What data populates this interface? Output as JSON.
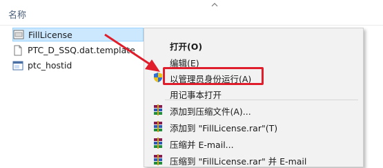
{
  "header": {
    "column_name": "名称"
  },
  "files": [
    {
      "name": "FillLicense",
      "icon": "shortcut-app-icon",
      "selected": true
    },
    {
      "name": "PTC_D_SSQ.dat.template",
      "icon": "document-file-icon",
      "selected": false
    },
    {
      "name": "ptc_hostid",
      "icon": "app-file-icon",
      "selected": false
    }
  ],
  "context_menu": {
    "items": [
      {
        "label": "打开(O)",
        "icon": "",
        "bold": true
      },
      {
        "label": "编辑(E)",
        "icon": ""
      },
      {
        "label": "以管理员身份运行(A)",
        "icon": "uac-shield-icon",
        "highlighted": true
      },
      {
        "label": "用记事本打开",
        "icon": ""
      },
      {
        "label": "添加到压缩文件(A)...",
        "icon": "winrar-icon"
      },
      {
        "label": "添加到 \"FillLicense.rar\"(T)",
        "icon": "winrar-icon"
      },
      {
        "label": "压缩并 E-mail...",
        "icon": "winrar-icon"
      },
      {
        "label": "压缩到 \"FillLicense.rar\" 并 E-mail",
        "icon": "winrar-icon"
      }
    ]
  },
  "colors": {
    "highlight_red": "#e01d2a",
    "selection_blue": "#cce8ff",
    "menu_bg": "#f2f2f2"
  }
}
